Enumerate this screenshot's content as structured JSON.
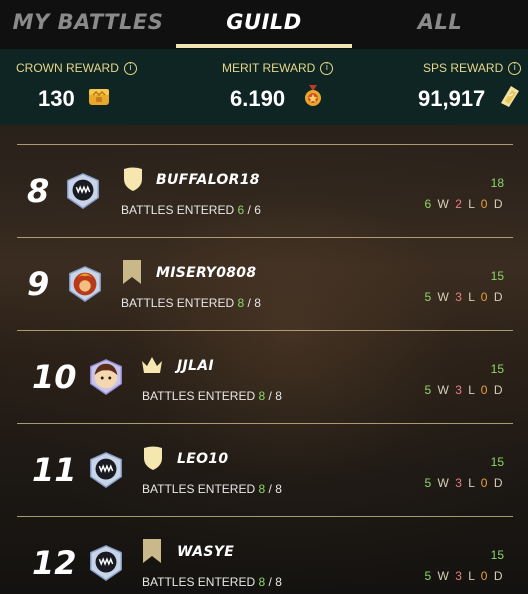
{
  "tabs": [
    {
      "label": "MY BATTLES",
      "active": false
    },
    {
      "label": "GUILD",
      "active": true
    },
    {
      "label": "ALL",
      "active": false
    }
  ],
  "rewards": {
    "crown": {
      "label": "CROWN REWARD",
      "info": "i",
      "value": "130",
      "icon": "crown-chest-icon"
    },
    "merit": {
      "label": "MERIT REWARD",
      "info": "i",
      "value": "6.190",
      "icon": "merit-medal-icon"
    },
    "sps": {
      "label": "SPS REWARD",
      "info": "i",
      "value": "91,917",
      "icon": "sps-token-icon"
    }
  },
  "rows": [
    {
      "rank": "8",
      "name": "BUFFALOR18",
      "badge": "shield",
      "entered_label": "BATTLES ENTERED",
      "entered": "6",
      "total": "6",
      "score": "18",
      "w": "6",
      "l": "2",
      "d": "0"
    },
    {
      "rank": "9",
      "name": "MISERY0808",
      "badge": "banner",
      "entered_label": "BATTLES ENTERED",
      "entered": "8",
      "total": "8",
      "score": "15",
      "w": "5",
      "l": "3",
      "d": "0"
    },
    {
      "rank": "10",
      "name": "JJLAI",
      "badge": "crown",
      "entered_label": "BATTLES ENTERED",
      "entered": "8",
      "total": "8",
      "score": "15",
      "w": "5",
      "l": "3",
      "d": "0"
    },
    {
      "rank": "11",
      "name": "LEO10",
      "badge": "shield",
      "entered_label": "BATTLES ENTERED",
      "entered": "8",
      "total": "8",
      "score": "15",
      "w": "5",
      "l": "3",
      "d": "0"
    },
    {
      "rank": "12",
      "name": "WASYE",
      "badge": "banner",
      "entered_label": "BATTLES ENTERED",
      "entered": "8",
      "total": "8",
      "score": "15",
      "w": "5",
      "l": "3",
      "d": "0"
    }
  ],
  "wld_letters": {
    "w": "W",
    "l": "L",
    "d": "D",
    "sep": "/"
  },
  "colors": {
    "accent": "#f2e3b3",
    "win": "#8dd66a",
    "loss": "#e88080",
    "draw": "#e8a040",
    "reward_bar": "#0f2524"
  }
}
